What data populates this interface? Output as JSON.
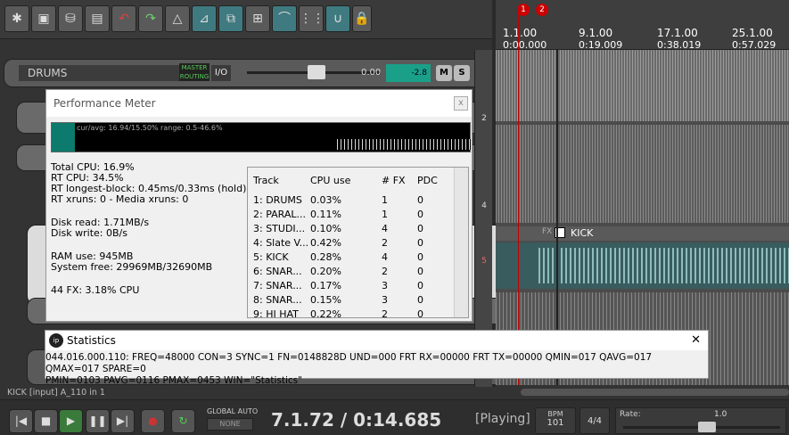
{
  "toolbar": {
    "icons": [
      "new-project-icon",
      "open-project-icon",
      "save-project-icon",
      "project-settings-icon",
      "undo-icon",
      "redo-icon",
      "metronome-icon",
      "snap-icon",
      "ripple-icon",
      "grid-icon",
      "envelope-icon",
      "grid-view-icon",
      "loop-icon",
      "lock-icon"
    ]
  },
  "tracks": {
    "drums": {
      "name": "DRUMS",
      "master_label": "MASTER",
      "rout_label": "ROUTING",
      "io": "I/O",
      "volume": "0.00",
      "pan": "-2.8",
      "mute": "M",
      "solo": "S"
    }
  },
  "tcp_numbers": [
    "2",
    "4",
    "5"
  ],
  "ruler": {
    "marker1": "1",
    "marker2": "2",
    "labels": [
      {
        "bar": "1.1.00",
        "time": "0:00.000"
      },
      {
        "bar": "9.1.00",
        "time": "0:19.009"
      },
      {
        "bar": "17.1.00",
        "time": "0:38.019"
      },
      {
        "bar": "25.1.00",
        "time": "0:57.029"
      }
    ]
  },
  "kick_item": {
    "name": "KICK",
    "fx_label": "FX"
  },
  "performance_meter": {
    "title": "Performance Meter",
    "close": "x",
    "cur_avg": "cur/avg: 16.94/15.50%  range: 0.5-46.6%",
    "lines": [
      "Total CPU: 16.9%",
      "RT CPU: 34.5%",
      "RT longest-block: 0.45ms/0.33ms (hold)",
      "RT xruns: 0 - Media xruns: 0",
      "Disk read: 1.71MB/s",
      "Disk write: 0B/s",
      "RAM use: 945MB",
      "System free: 29969MB/32690MB",
      "44 FX: 3.18% CPU"
    ],
    "table": {
      "headers": [
        "Track",
        "CPU use",
        "# FX",
        "PDC"
      ],
      "rows": [
        [
          "1: DRUMS",
          "0.03%",
          "1",
          "0"
        ],
        [
          "2: PARAL...",
          "0.11%",
          "1",
          "0"
        ],
        [
          "3: STUDI...",
          "0.10%",
          "4",
          "0"
        ],
        [
          "4: Slate V...",
          "0.42%",
          "2",
          "0"
        ],
        [
          "5: KICK",
          "0.28%",
          "4",
          "0"
        ],
        [
          "6: SNAR...",
          "0.20%",
          "2",
          "0"
        ],
        [
          "7: SNAR...",
          "0.17%",
          "3",
          "0"
        ],
        [
          "8: SNAR...",
          "0.15%",
          "3",
          "0"
        ],
        [
          "9: HI HAT",
          "0.22%",
          "2",
          "0"
        ]
      ]
    }
  },
  "statistics": {
    "title": "Statistics",
    "close": "✕",
    "line1": "044.016.000.110: FREQ=48000 CON=3 SYNC=1 FN=0148828D UND=000 FRT RX=00000 FRT TX=00000 QMIN=017 QAVG=017 QMAX=017 SPARE=0",
    "line2": "PMIN=0103 PAVG=0116 PMAX=0453 WIN=\"Statistics\""
  },
  "status_bar": "KICK [input] A_110 in 1",
  "transport": {
    "global_auto": "GLOBAL AUTO",
    "none": "NONE",
    "position": "7.1.72 / 0:14.685",
    "state": "[Playing]",
    "bpm_label": "BPM",
    "bpm": "101",
    "time_sig": "4/4",
    "rate_label": "Rate:",
    "rate": "1.0"
  },
  "colors": {
    "accent": "#3f7a80",
    "meter_green": "#1aa088",
    "waveform": "#7fa8a8",
    "playhead": "#c00000"
  }
}
